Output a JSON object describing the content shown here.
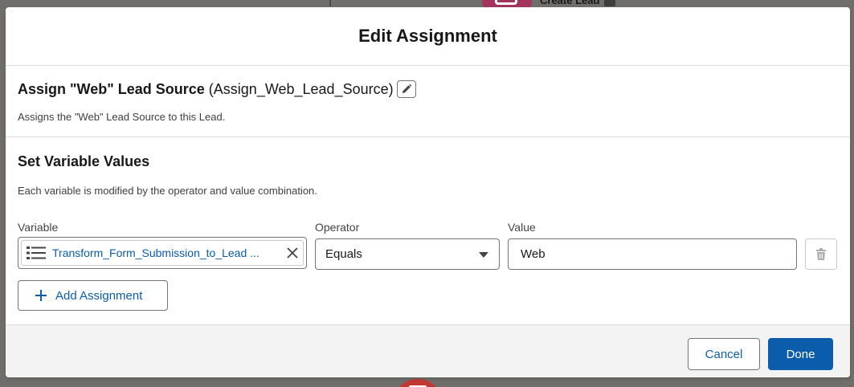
{
  "background": {
    "node_label": "Create Lead"
  },
  "modal": {
    "title": "Edit Assignment"
  },
  "element": {
    "label": "Assign \"Web\" Lead Source",
    "api_name": "(Assign_Web_Lead_Source)",
    "description": "Assigns the \"Web\" Lead Source to this Lead."
  },
  "variables": {
    "section_title": "Set Variable Values",
    "help_text": "Each variable is modified by the operator and value combination.",
    "labels": {
      "variable": "Variable",
      "operator": "Operator",
      "value": "Value"
    },
    "rows": [
      {
        "variable": "Transform_Form_Submission_to_Lead ...",
        "operator": "Equals",
        "value": "Web"
      }
    ],
    "add_button_label": "Add Assignment"
  },
  "footer": {
    "cancel_label": "Cancel",
    "done_label": "Done"
  },
  "colors": {
    "brand": "#0b5cab",
    "backdrop": "#706e6b",
    "footer_bg": "#f3f3f3"
  }
}
